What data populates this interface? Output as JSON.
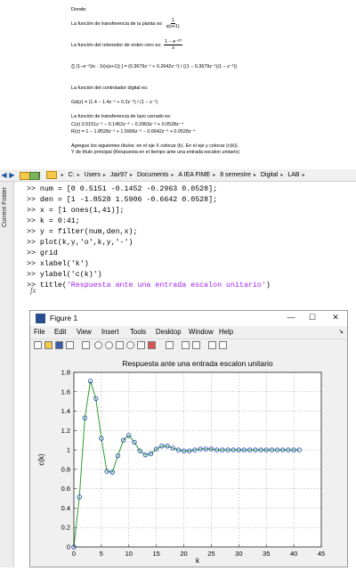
{
  "document": {
    "lines": {
      "donde": "Donde:",
      "planta_prefix": "La función de transferencia de la planta es:",
      "planta_num": "1",
      "planta_den": "s(s+1)",
      "retenedor_prefix": "La función del retenedor de orden cero es:",
      "retenedor_num": "1 − e⁻ˢᵀ",
      "retenedor_den": "s",
      "z_transform": "ζ[ (1−e⁻ˢ)/s · 1/(s(s+1)) ] = (0.3679z⁻¹ + 0.2642z⁻²) / ((1 − 0.3679z⁻¹)(1 − z⁻¹))",
      "controlador": "La función del controlador digital es:",
      "gd": "Gd(z) = (1.4 − 1.4z⁻¹ + 0.2z⁻²) / (1 − z⁻¹)",
      "lazo": "La función de transferencia de lazo cerrado es:",
      "cz_num": "C(z)      0.5151z⁻¹ − 0.1452z⁻² − 0.2963z⁻³ + 0.0528z⁻⁴",
      "cz_den": "R(z) = 1 − 1.8528z⁻¹ + 1.5906z⁻² − 0.6642z⁻³ + 0.0528z⁻⁴",
      "agregue1": "Agregue los siguientes títulos: en el eje X colocar (k). En el eje y colocar (c(k)).",
      "agregue2": "Y de título principal (Respuesta en el tiempo ante una entrada escalon unitario)"
    }
  },
  "path_bar": {
    "segments": [
      "C:",
      "Users",
      "Jair97",
      "Documents",
      "A IEA FIME",
      "8 semestre",
      "Digital",
      "LAB"
    ]
  },
  "sidebar": {
    "label": "Current Folder"
  },
  "console": {
    "lines": [
      ">> num = [0 0.5151 -0.1452 -0.2963 0.0528];",
      ">> den = [1 -1.8528 1.5906 -0.6642 0.0528];",
      ">> x = [1 ones(1,41)];",
      ">> k = 0:41;",
      ">> y = filter(num,den,x);",
      ">> plot(k,y,'o',k,y,'-')",
      ">> grid",
      ">> xlabel('k')",
      ">> ylabel('c(k)')",
      ">> title('Respuesta ante una entrada escalon unitario')"
    ],
    "fx": "fx"
  },
  "figure": {
    "window_title": "Figure 1",
    "minimize": "—",
    "maximize": "☐",
    "close": "✕",
    "menu": [
      "File",
      "Edit",
      "View",
      "Insert",
      "Tools",
      "Desktop",
      "Window",
      "Help"
    ]
  },
  "chart_data": {
    "type": "line",
    "title": "Respuesta ante una entrada escalon unitario",
    "xlabel": "k",
    "ylabel": "c(k)",
    "xlim": [
      0,
      45
    ],
    "ylim": [
      0,
      1.8
    ],
    "xticks": [
      0,
      5,
      10,
      15,
      20,
      25,
      30,
      35,
      40,
      45
    ],
    "yticks": [
      0,
      0.2,
      0.4,
      0.6,
      0.8,
      1,
      1.2,
      1.4,
      1.6,
      1.8
    ],
    "grid": true,
    "marker_color": "#1f3fbf",
    "line_color": "#2ca02c",
    "x": [
      0,
      1,
      2,
      3,
      4,
      5,
      6,
      7,
      8,
      9,
      10,
      11,
      12,
      13,
      14,
      15,
      16,
      17,
      18,
      19,
      20,
      21,
      22,
      23,
      24,
      25,
      26,
      27,
      28,
      29,
      30,
      31,
      32,
      33,
      34,
      35,
      36,
      37,
      38,
      39,
      40,
      41
    ],
    "y": [
      0,
      0.515,
      1.33,
      1.71,
      1.53,
      1.12,
      0.78,
      0.77,
      0.94,
      1.1,
      1.15,
      1.08,
      0.99,
      0.95,
      0.96,
      1.01,
      1.04,
      1.04,
      1.02,
      1.0,
      0.99,
      0.99,
      1.0,
      1.01,
      1.01,
      1.01,
      1.0,
      1.0,
      1.0,
      1.0,
      1.0,
      1.0,
      1.0,
      1.0,
      1.0,
      1.0,
      1.0,
      1.0,
      1.0,
      1.0,
      1.0,
      1.0
    ]
  }
}
